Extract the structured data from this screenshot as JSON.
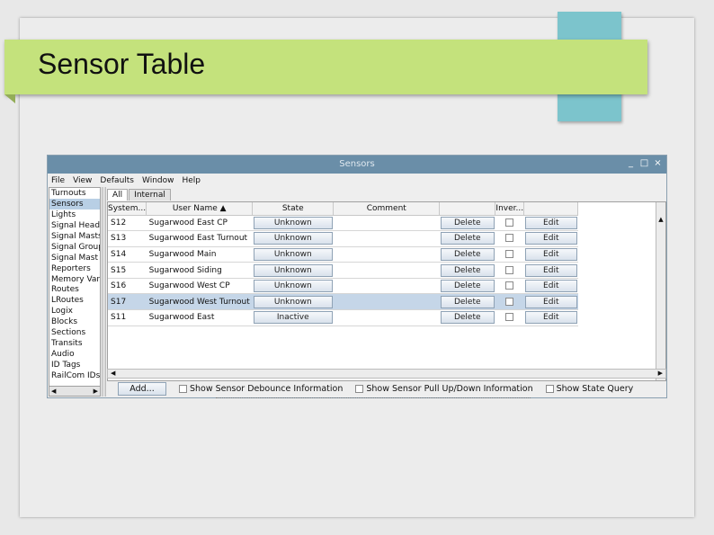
{
  "slide": {
    "title": "Sensor Table"
  },
  "window": {
    "title": "Sensors",
    "controls": [
      "_",
      "□",
      "×"
    ],
    "menu": [
      "File",
      "View",
      "Defaults",
      "Window",
      "Help"
    ]
  },
  "left_list": {
    "items": [
      "Turnouts",
      "Sensors",
      "Lights",
      "Signal Heads",
      "Signal Masts",
      "Signal Groups",
      "Signal Mast Logic",
      "Reporters",
      "Memory Variables",
      "Routes",
      "LRoutes",
      "Logix",
      "Blocks",
      "Sections",
      "Transits",
      "Audio",
      "ID Tags",
      "RailCom IDs"
    ],
    "selected_index": 1
  },
  "tabs": [
    {
      "label": "All",
      "active": true
    },
    {
      "label": "Internal",
      "active": false
    }
  ],
  "table": {
    "headers": [
      "System...",
      "User Name",
      "State",
      "Comment",
      "",
      "Inver...",
      ""
    ],
    "sort_indicator": "▲",
    "rows": [
      {
        "system": "S12",
        "user": "Sugarwood East CP",
        "state": "Unknown",
        "comment": "",
        "delete": "Delete",
        "inverted": false,
        "edit": "Edit",
        "selected": false
      },
      {
        "system": "S13",
        "user": "Sugarwood East Turnout",
        "state": "Unknown",
        "comment": "",
        "delete": "Delete",
        "inverted": false,
        "edit": "Edit",
        "selected": false
      },
      {
        "system": "S14",
        "user": "Sugarwood Main",
        "state": "Unknown",
        "comment": "",
        "delete": "Delete",
        "inverted": false,
        "edit": "Edit",
        "selected": false
      },
      {
        "system": "S15",
        "user": "Sugarwood Siding",
        "state": "Unknown",
        "comment": "",
        "delete": "Delete",
        "inverted": false,
        "edit": "Edit",
        "selected": false
      },
      {
        "system": "S16",
        "user": "Sugarwood West CP",
        "state": "Unknown",
        "comment": "",
        "delete": "Delete",
        "inverted": false,
        "edit": "Edit",
        "selected": false
      },
      {
        "system": "S17",
        "user": "Sugarwood West Turnout",
        "state": "Unknown",
        "comment": "",
        "delete": "Delete",
        "inverted": false,
        "edit": "Edit",
        "selected": true
      },
      {
        "system": "S11",
        "user": "Sugarwood East",
        "state": "Inactive",
        "comment": "",
        "delete": "Delete",
        "inverted": false,
        "edit": "Edit",
        "selected": false
      }
    ]
  },
  "bottom": {
    "add_label": "Add...",
    "options": [
      "Show Sensor Debounce Information",
      "Show Sensor Pull Up/Down Information",
      "Show State Query"
    ]
  },
  "colors": {
    "title_band": "#c4e27c",
    "accent_teal": "#7cc4cc",
    "titlebar": "#6a8ea8",
    "selection": "#c5d6e8"
  }
}
